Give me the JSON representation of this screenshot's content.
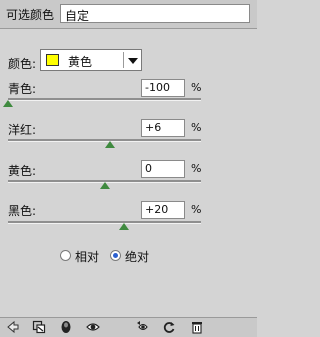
{
  "header": {
    "title": "可选颜色",
    "preset_value": "自定"
  },
  "color_selector": {
    "label": "颜色:",
    "selected": "黄色",
    "swatch_color": "#ffff00"
  },
  "sliders": [
    {
      "label": "青色:",
      "value": "-100",
      "unit": "%",
      "level_percent": -100
    },
    {
      "label": "洋红:",
      "value": "+6",
      "unit": "%",
      "level_percent": 6
    },
    {
      "label": "黄色:",
      "value": "0",
      "unit": "%",
      "level_percent": 0
    },
    {
      "label": "黑色:",
      "value": "+20",
      "unit": "%",
      "level_percent": 20
    }
  ],
  "method": {
    "options": [
      "相对",
      "绝对"
    ],
    "selected": "绝对"
  },
  "bottom_toolbar": {
    "icons": [
      "back-arrow-icon",
      "clip-layer-icon",
      "visibility-toggle-icon",
      "eye-icon",
      "view-previous-icon",
      "reset-icon",
      "trash-icon"
    ]
  }
}
